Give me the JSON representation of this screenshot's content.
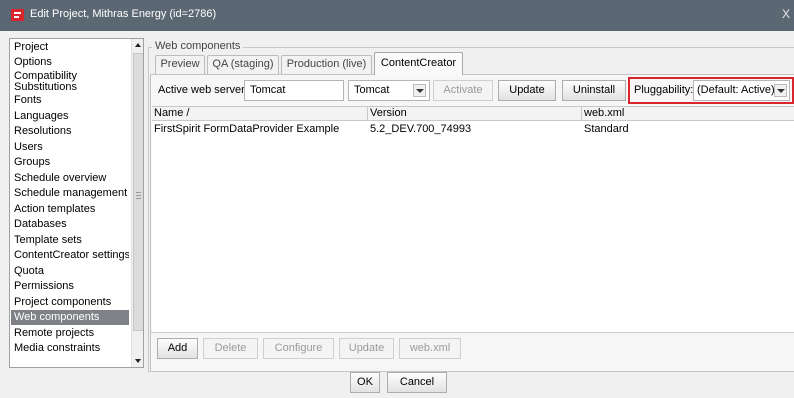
{
  "window": {
    "title": "Edit Project, Mithras Energy (id=2786)",
    "close_label": "X"
  },
  "nav": {
    "items": [
      {
        "label": "Project"
      },
      {
        "label": "Options"
      },
      {
        "label": "Compatibility Substitutions"
      },
      {
        "label": "Fonts"
      },
      {
        "label": "Languages"
      },
      {
        "label": "Resolutions"
      },
      {
        "label": "Users"
      },
      {
        "label": "Groups"
      },
      {
        "label": "Schedule overview"
      },
      {
        "label": "Schedule management"
      },
      {
        "label": "Action templates"
      },
      {
        "label": "Databases"
      },
      {
        "label": "Template sets"
      },
      {
        "label": "ContentCreator settings"
      },
      {
        "label": "Quota"
      },
      {
        "label": "Permissions"
      },
      {
        "label": "Project components"
      },
      {
        "label": "Web components"
      },
      {
        "label": "Remote projects"
      },
      {
        "label": "Media constraints"
      }
    ],
    "selected": "Web components"
  },
  "group": {
    "title": "Web components"
  },
  "tabs": [
    {
      "label": "Preview"
    },
    {
      "label": "QA (staging)"
    },
    {
      "label": "Production (live)"
    },
    {
      "label": "ContentCreator"
    }
  ],
  "active_tab": "ContentCreator",
  "server": {
    "label": "Active web server:",
    "value": "Tomcat",
    "select_value": "Tomcat",
    "activate_label": "Activate",
    "update_label": "Update",
    "uninstall_label": "Uninstall",
    "pluggability_label": "Pluggability:",
    "pluggability_value": "(Default: Active)"
  },
  "table": {
    "columns": [
      {
        "label": "Name /"
      },
      {
        "label": "Version"
      },
      {
        "label": "web.xml"
      }
    ],
    "rows": [
      {
        "name": "FirstSpirit FormDataProvider Example",
        "version": "5.2_DEV.700_74993",
        "webxml": "Standard"
      }
    ]
  },
  "bottom_buttons": {
    "add": "Add",
    "delete": "Delete",
    "configure": "Configure",
    "update": "Update",
    "webxml": "web.xml"
  },
  "dialog": {
    "ok": "OK",
    "cancel": "Cancel"
  },
  "colors": {
    "titlebar": "#5b6874",
    "selection": "#7e8287",
    "highlight": "#d9262c"
  }
}
